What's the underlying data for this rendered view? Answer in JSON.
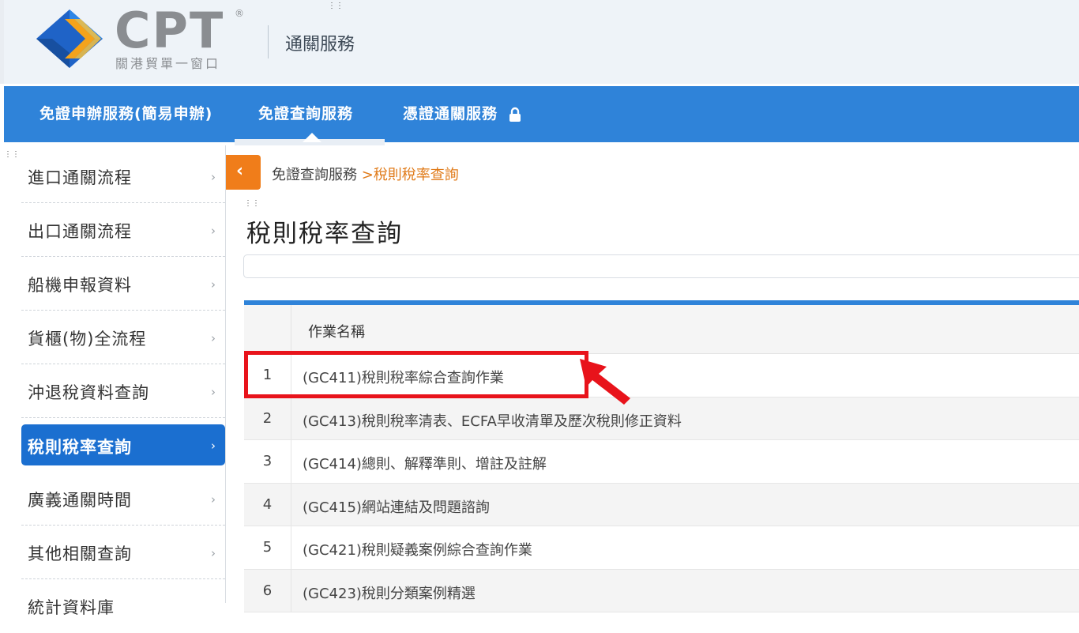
{
  "header": {
    "logo_text": "CPT",
    "logo_reg": "®",
    "logo_subtitle": "關港貿單一窗口",
    "title": "通關服務"
  },
  "nav": {
    "items": [
      {
        "label": "免證申辦服務(簡易申辦)"
      },
      {
        "label": "免證查詢服務"
      },
      {
        "label": "憑證通關服務"
      }
    ],
    "active_index": 1
  },
  "sidebar": {
    "items": [
      {
        "label": "進口通關流程"
      },
      {
        "label": "出口通關流程"
      },
      {
        "label": "船機申報資料"
      },
      {
        "label": "貨櫃(物)全流程"
      },
      {
        "label": "沖退稅資料查詢"
      },
      {
        "label": "稅則稅率查詢"
      },
      {
        "label": "廣義通關時間"
      },
      {
        "label": "其他相關查詢"
      },
      {
        "label": "統計資料庫"
      }
    ],
    "active_index": 5
  },
  "breadcrumb": {
    "parent": "免證查詢服務",
    "separator": " >",
    "current": "稅則稅率查詢"
  },
  "page_title": "稅則稅率查詢",
  "table": {
    "header_name": "作業名稱",
    "rows": [
      {
        "no": "1",
        "name": "(GC411)稅則稅率綜合查詢作業"
      },
      {
        "no": "2",
        "name": "(GC413)稅則稅率清表、ECFA早收清單及歷次稅則修正資料"
      },
      {
        "no": "3",
        "name": "(GC414)總則、解釋準則、增註及註解"
      },
      {
        "no": "4",
        "name": "(GC415)網站連結及問題諮詢"
      },
      {
        "no": "5",
        "name": "(GC421)稅則疑義案例綜合查詢作業"
      },
      {
        "no": "6",
        "name": "(GC423)稅則分類案例精選"
      }
    ]
  },
  "colors": {
    "nav_bg": "#2f83d9",
    "active_side": "#1b6fd0",
    "accent_orange": "#f07d1a",
    "highlight_red": "#e8131b"
  },
  "icons": {
    "lock": "lock-icon",
    "collapse": "chevron-left-icon",
    "side_chevron": "chevron-right-icon"
  }
}
